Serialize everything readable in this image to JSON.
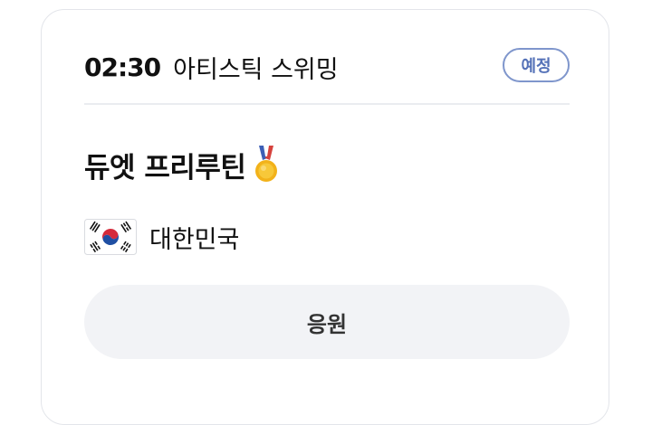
{
  "match": {
    "time": "02:30",
    "sport": "아티스틱 스위밍",
    "status_badge": "예정",
    "event_name": "듀엣 프리루틴",
    "medal_icon": "gold-medal-icon",
    "country": "대한민국",
    "flag_icon": "south-korea-flag-icon",
    "cheer_button_label": "응원"
  },
  "colors": {
    "badge_border": "#7f96cc",
    "badge_text": "#5572b8",
    "button_bg": "#f2f3f6",
    "card_border": "#e3e5ea"
  }
}
